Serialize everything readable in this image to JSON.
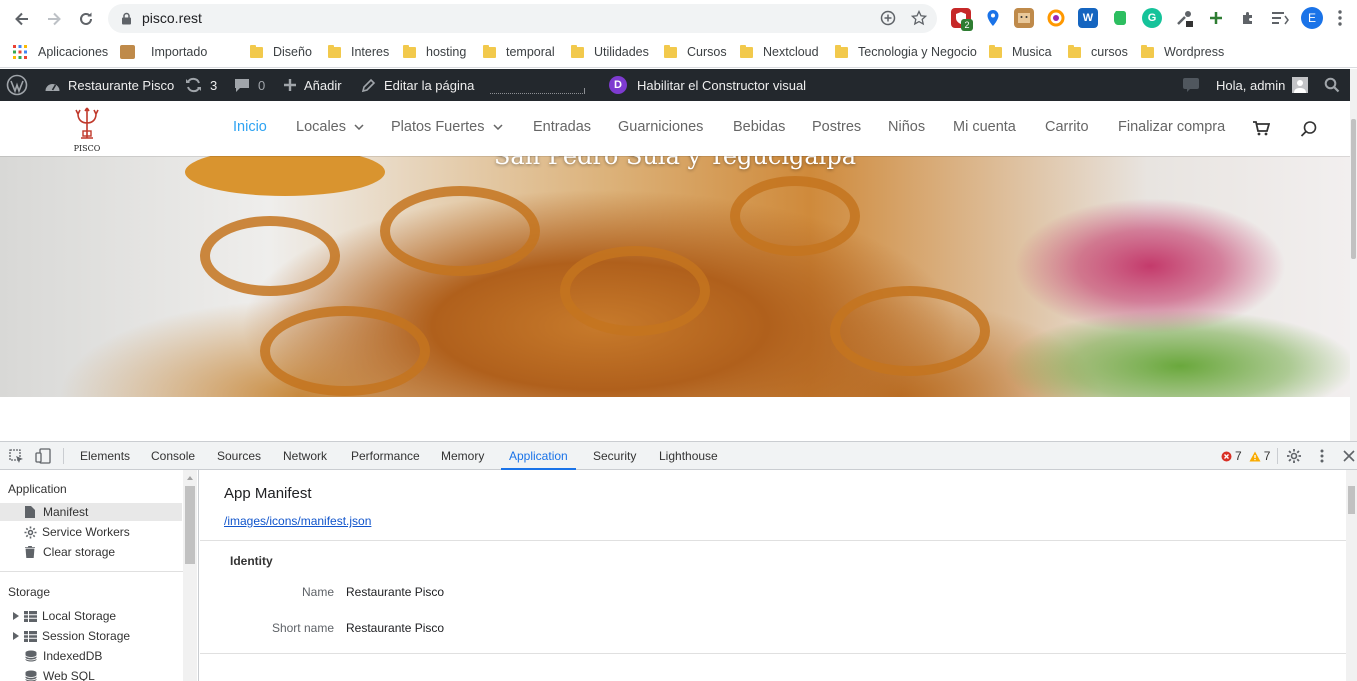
{
  "browser": {
    "url": "pisco.rest",
    "profile_initial": "E",
    "shield_badge": "2",
    "bookmarks": [
      {
        "label": "Aplicaciones",
        "kind": "apps"
      },
      {
        "label": "Importado",
        "kind": "folder-face"
      },
      {
        "label": "Diseño",
        "kind": "folder"
      },
      {
        "label": "Interes",
        "kind": "folder"
      },
      {
        "label": "hosting",
        "kind": "folder"
      },
      {
        "label": "temporal",
        "kind": "folder"
      },
      {
        "label": "Utilidades",
        "kind": "folder"
      },
      {
        "label": "Cursos",
        "kind": "folder"
      },
      {
        "label": "Nextcloud",
        "kind": "folder"
      },
      {
        "label": "Tecnologia y Negocio",
        "kind": "folder"
      },
      {
        "label": "Musica",
        "kind": "folder"
      },
      {
        "label": "cursos",
        "kind": "folder"
      },
      {
        "label": "Wordpress",
        "kind": "folder"
      }
    ]
  },
  "adminbar": {
    "site_name": "Restaurante Pisco",
    "updates_count": "3",
    "comments_count": "0",
    "add_label": "Añadir",
    "edit_label": "Editar la página",
    "visual_builder_label": "Habilitar el Constructor visual",
    "greeting": "Hola, admin"
  },
  "site": {
    "logo_text": "PISCO",
    "nav": [
      {
        "label": "Inicio",
        "active": true,
        "dropdown": false
      },
      {
        "label": "Locales",
        "active": false,
        "dropdown": true
      },
      {
        "label": "Platos Fuertes",
        "active": false,
        "dropdown": true
      },
      {
        "label": "Entradas",
        "active": false,
        "dropdown": false
      },
      {
        "label": "Guarniciones",
        "active": false,
        "dropdown": false
      },
      {
        "label": "Bebidas",
        "active": false,
        "dropdown": false
      },
      {
        "label": "Postres",
        "active": false,
        "dropdown": false
      },
      {
        "label": "Niños",
        "active": false,
        "dropdown": false
      },
      {
        "label": "Mi cuenta",
        "active": false,
        "dropdown": false
      },
      {
        "label": "Carrito",
        "active": false,
        "dropdown": false
      },
      {
        "label": "Finalizar compra",
        "active": false,
        "dropdown": false
      }
    ],
    "hero_title": "San Pedro Sula y Tegucigalpa",
    "accent_color": "#2ea3f2"
  },
  "devtools": {
    "tabs": [
      "Elements",
      "Console",
      "Sources",
      "Network",
      "Performance",
      "Memory",
      "Application",
      "Security",
      "Lighthouse"
    ],
    "selected_tab": "Application",
    "error_count": "7",
    "warning_count": "7",
    "sidebar": {
      "application_header": "Application",
      "application_items": [
        "Manifest",
        "Service Workers",
        "Clear storage"
      ],
      "selected_item": "Manifest",
      "storage_header": "Storage",
      "storage_items": [
        "Local Storage",
        "Session Storage",
        "IndexedDB",
        "Web SQL"
      ]
    },
    "manifest": {
      "title": "App Manifest",
      "link": "/images/icons/manifest.json",
      "section": "Identity",
      "fields": [
        {
          "key": "Name",
          "value": "Restaurante Pisco"
        },
        {
          "key": "Short name",
          "value": "Restaurante Pisco"
        }
      ]
    }
  }
}
